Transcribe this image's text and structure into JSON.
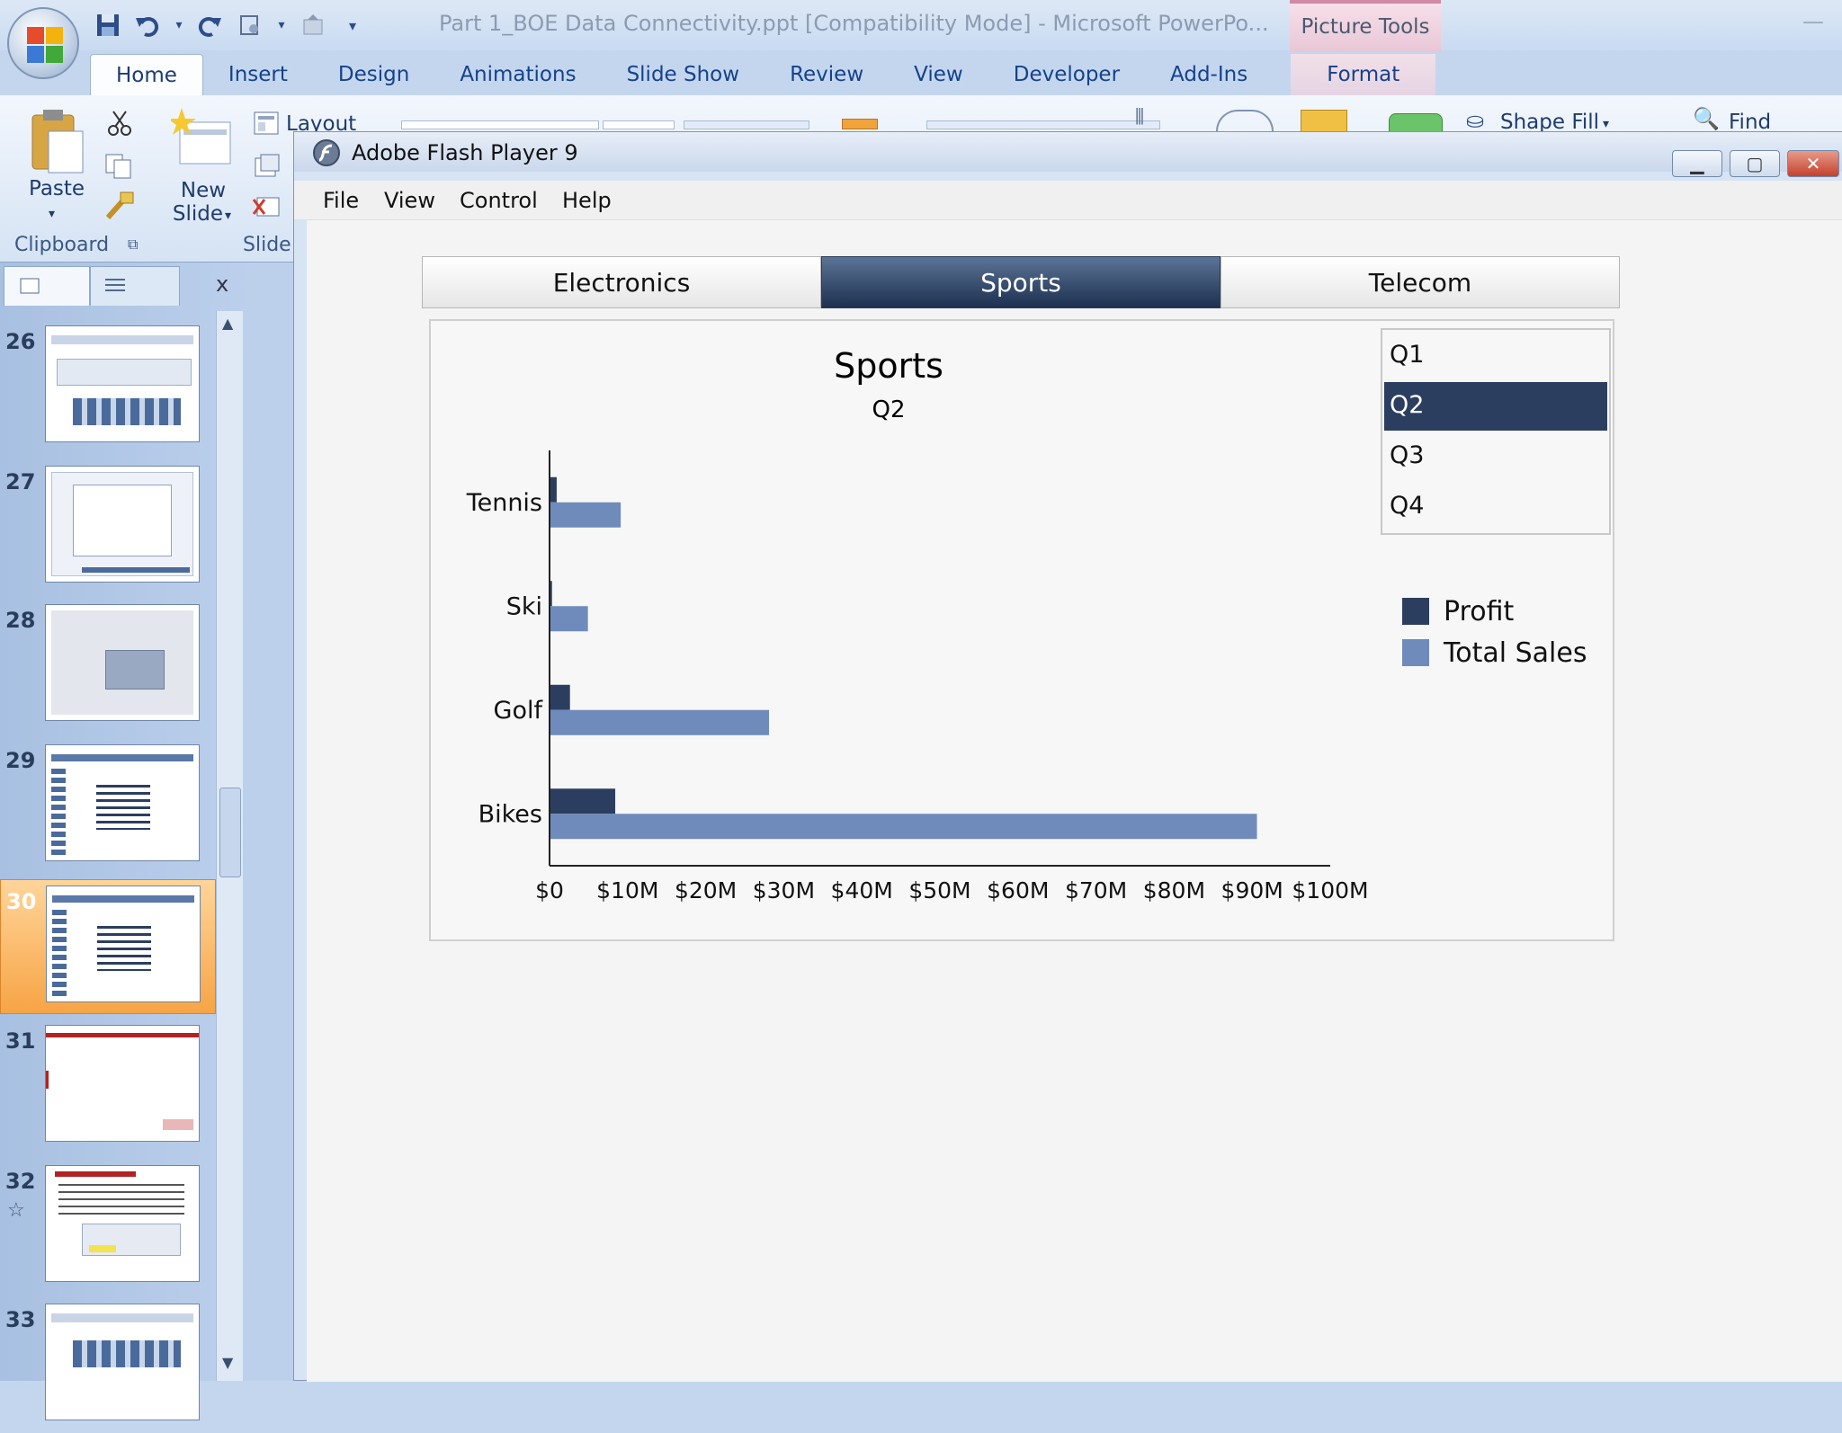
{
  "powerpoint": {
    "title": "Part 1_BOE Data Connectivity.ppt [Compatibility Mode] - Microsoft PowerPo...",
    "contextual_tab_group": "Picture Tools",
    "tabs": [
      "Home",
      "Insert",
      "Design",
      "Animations",
      "Slide Show",
      "Review",
      "View",
      "Developer",
      "Add-Ins",
      "Format"
    ],
    "active_tab": "Home",
    "ribbon": {
      "paste_label": "Paste",
      "new_slide_label_1": "New",
      "new_slide_label_2": "Slide",
      "layout_label": "Layout",
      "clipboard_group": "Clipboard",
      "slides_group": "Slide",
      "shape_fill_label": "Shape Fill",
      "find_label": "Find"
    },
    "slides": [
      {
        "number": "26"
      },
      {
        "number": "27"
      },
      {
        "number": "28"
      },
      {
        "number": "29"
      },
      {
        "number": "30",
        "selected": true
      },
      {
        "number": "31"
      },
      {
        "number": "32"
      },
      {
        "number": "33"
      }
    ],
    "panel_close": "x"
  },
  "flash_player": {
    "title": "Adobe Flash Player 9",
    "menu": [
      "File",
      "View",
      "Control",
      "Help"
    ],
    "app": {
      "tabs": [
        "Electronics",
        "Sports",
        "Telecom"
      ],
      "active_tab": "Sports",
      "quarters": [
        "Q1",
        "Q2",
        "Q3",
        "Q4"
      ],
      "selected_quarter": "Q2",
      "legend": [
        {
          "label": "Profit",
          "color": "#2c3e60"
        },
        {
          "label": "Total Sales",
          "color": "#6f8bbb"
        }
      ]
    }
  },
  "chart_data": {
    "type": "bar",
    "orientation": "horizontal",
    "title": "Sports",
    "subtitle": "Q2",
    "categories": [
      "Tennis",
      "Ski",
      "Golf",
      "Bikes"
    ],
    "series": [
      {
        "name": "Profit",
        "color": "#2c3e60",
        "values": [
          0.8,
          0.2,
          2.5,
          8.3
        ]
      },
      {
        "name": "Total Sales",
        "color": "#6f8bbb",
        "values": [
          9,
          4.8,
          28,
          90.5
        ]
      }
    ],
    "xlim": [
      0,
      100
    ],
    "x_ticks": [
      "$0",
      "$10M",
      "$20M",
      "$30M",
      "$40M",
      "$50M",
      "$60M",
      "$70M",
      "$80M",
      "$90M",
      "$100M"
    ],
    "grid": false,
    "legend_position": "right"
  }
}
